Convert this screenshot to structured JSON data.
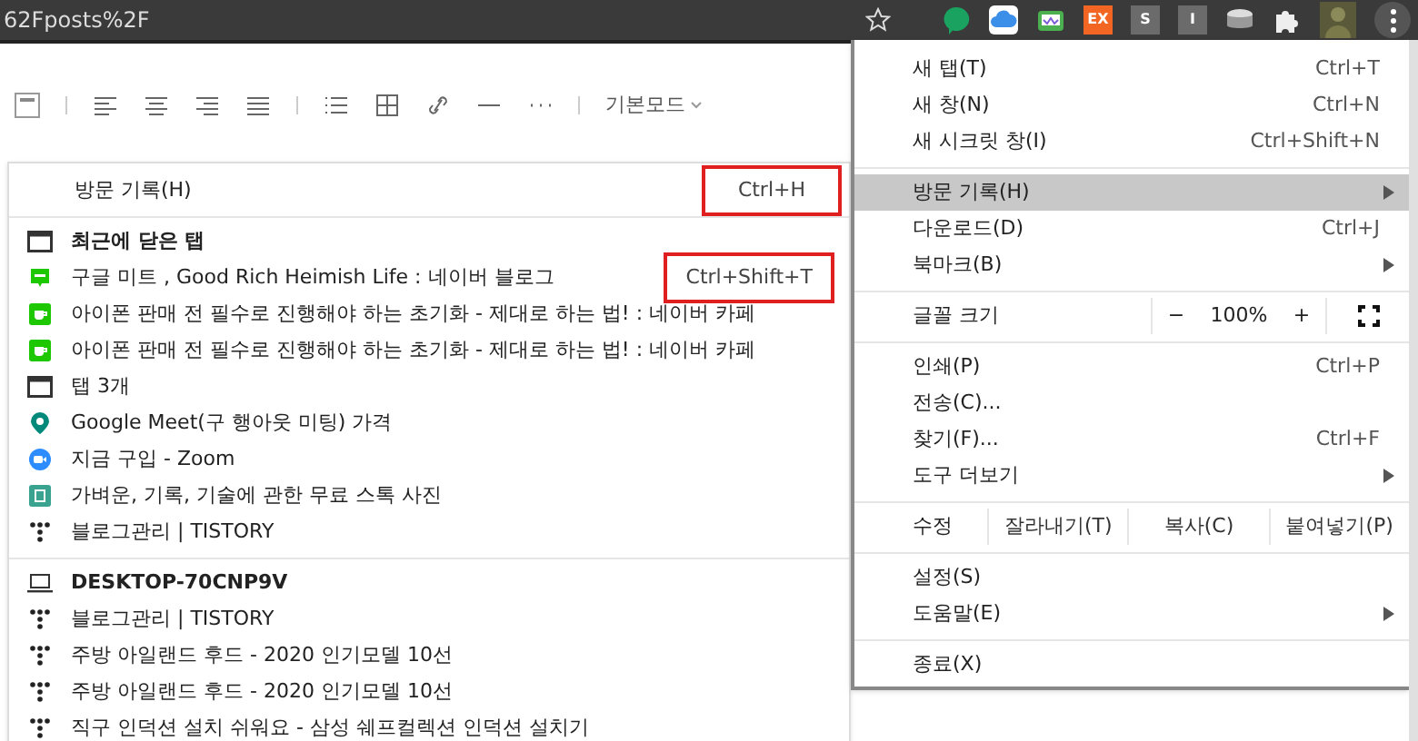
{
  "browser": {
    "address_text": "62Fposts%2F",
    "extensions": [
      {
        "kind": "bubble"
      },
      {
        "kind": "cloud"
      },
      {
        "kind": "mail"
      },
      {
        "kind": "badge",
        "label": "EX",
        "color": "#f26522"
      },
      {
        "kind": "badge",
        "label": "S",
        "color": "#6b6b6b"
      },
      {
        "kind": "badge",
        "label": "I",
        "color": "#6b6b6b"
      },
      {
        "kind": "drum"
      },
      {
        "kind": "puzzle"
      },
      {
        "kind": "avatar"
      }
    ]
  },
  "editor_toolbar": {
    "mode_dropdown": "기본모드"
  },
  "history_submenu": {
    "title": {
      "label": "방문 기록(H)",
      "shortcut": "Ctrl+H",
      "outlined": true
    },
    "groups": [
      {
        "heading": {
          "label": "최근에 닫은 탭",
          "kind": "window"
        },
        "items": [
          {
            "label": "구글 미트 , Good Rich  Heimish Life : 네이버 블로그",
            "kind": "blog",
            "shortcut": "Ctrl+Shift+T",
            "outlined": true
          },
          {
            "label": "아이폰 판매 전 필수로 진행해야 하는 초기화 - 제대로 하는 법! : 네이버 카페",
            "kind": "cafe"
          },
          {
            "label": "아이폰 판매 전 필수로 진행해야 하는 초기화 - 제대로 하는 법! : 네이버 카페",
            "kind": "cafe"
          },
          {
            "label": "탭 3개",
            "kind": "window"
          },
          {
            "label": "Google Meet(구 행아웃 미팅) 가격",
            "kind": "meet"
          },
          {
            "label": "지금 구입 - Zoom",
            "kind": "zoom"
          },
          {
            "label": "가벼운, 기록, 기술에 관한 무료 스톡 사진",
            "kind": "photo"
          },
          {
            "label": "블로그관리 | TISTORY",
            "kind": "tistory"
          }
        ]
      },
      {
        "heading": {
          "label": "DESKTOP-70CNP9V",
          "kind": "laptop"
        },
        "items": [
          {
            "label": "블로그관리 | TISTORY",
            "kind": "tistory"
          },
          {
            "label": "주방 아일랜드 후드 - 2020 인기모델 10선",
            "kind": "tistory"
          },
          {
            "label": "주방 아일랜드 후드 - 2020 인기모델 10선",
            "kind": "tistory"
          },
          {
            "label": "직구 인덕션 설치 쉬워요 - 삼성 쉐프컬렉션 인덕션 설치기",
            "kind": "tistory"
          }
        ]
      }
    ]
  },
  "main_menu": [
    {
      "kind": "item",
      "label": "새 탭(T)",
      "shortcut": "Ctrl+T",
      "submenu": false,
      "selected": false
    },
    {
      "kind": "item",
      "label": "새 창(N)",
      "shortcut": "Ctrl+N",
      "submenu": false,
      "selected": false
    },
    {
      "kind": "item",
      "label": "새 시크릿 창(I)",
      "shortcut": "Ctrl+Shift+N",
      "submenu": false,
      "selected": false
    },
    {
      "kind": "separator"
    },
    {
      "kind": "item",
      "label": "방문 기록(H)",
      "submenu": true,
      "selected": true
    },
    {
      "kind": "item",
      "label": "다운로드(D)",
      "shortcut": "Ctrl+J",
      "submenu": false,
      "selected": false
    },
    {
      "kind": "item",
      "label": "북마크(B)",
      "submenu": true,
      "selected": false
    },
    {
      "kind": "separator"
    },
    {
      "kind": "zoom",
      "label": "글꼴 크기",
      "minus": "−",
      "value": "100%",
      "plus": "+"
    },
    {
      "kind": "separator"
    },
    {
      "kind": "item",
      "label": "인쇄(P)",
      "shortcut": "Ctrl+P",
      "submenu": false,
      "selected": false
    },
    {
      "kind": "item",
      "label": "전송(C)...",
      "submenu": false,
      "selected": false
    },
    {
      "kind": "item",
      "label": "찾기(F)...",
      "shortcut": "Ctrl+F",
      "submenu": false,
      "selected": false
    },
    {
      "kind": "item",
      "label": "도구 더보기",
      "submenu": true,
      "selected": false
    },
    {
      "kind": "separator"
    },
    {
      "kind": "edit",
      "label": "수정",
      "buttons": [
        "잘라내기(T)",
        "복사(C)",
        "붙여넣기(P)"
      ]
    },
    {
      "kind": "separator"
    },
    {
      "kind": "item",
      "label": "설정(S)",
      "submenu": false,
      "selected": false
    },
    {
      "kind": "item",
      "label": "도움말(E)",
      "submenu": true,
      "selected": false
    },
    {
      "kind": "separator"
    },
    {
      "kind": "item",
      "label": "종료(X)",
      "submenu": false,
      "selected": false
    }
  ]
}
